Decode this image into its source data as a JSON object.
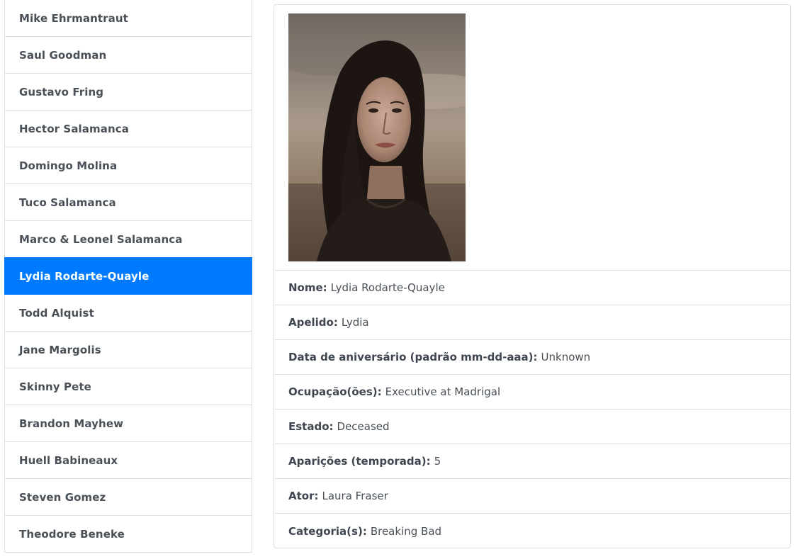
{
  "characters": {
    "items": [
      {
        "label": "Mike Ehrmantraut"
      },
      {
        "label": "Saul Goodman"
      },
      {
        "label": "Gustavo Fring"
      },
      {
        "label": "Hector Salamanca"
      },
      {
        "label": "Domingo Molina"
      },
      {
        "label": "Tuco Salamanca"
      },
      {
        "label": "Marco & Leonel Salamanca"
      },
      {
        "label": "Lydia Rodarte-Quayle"
      },
      {
        "label": "Todd Alquist"
      },
      {
        "label": "Jane Margolis"
      },
      {
        "label": "Skinny Pete"
      },
      {
        "label": "Brandon Mayhew"
      },
      {
        "label": "Huell Babineaux"
      },
      {
        "label": "Steven Gomez"
      },
      {
        "label": "Theodore Beneke"
      }
    ],
    "active_index": 7,
    "active_color": "#007bff"
  },
  "details": {
    "name_label": "Nome:",
    "name_value": "Lydia Rodarte-Quayle",
    "nickname_label": "Apelido:",
    "nickname_value": "Lydia",
    "birthday_label": "Data de aniversário (padrão mm-dd-aaa):",
    "birthday_value": "Unknown",
    "occupation_label": "Ocupação(ões):",
    "occupation_value": "Executive at Madrigal",
    "status_label": "Estado:",
    "status_value": "Deceased",
    "appearance_label": "Aparições (temporada):",
    "appearance_value": "5",
    "actor_label": "Ator:",
    "actor_value": "Laura Fraser",
    "category_label": "Categoria(s):",
    "category_value": "Breaking Bad"
  }
}
